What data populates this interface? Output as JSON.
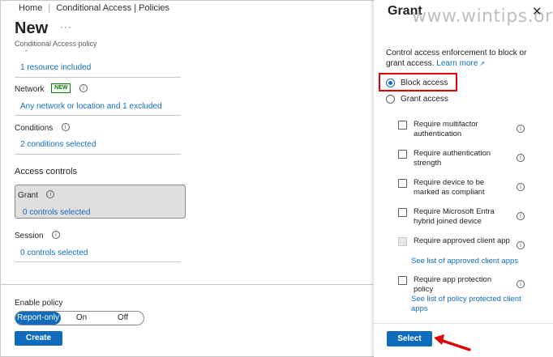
{
  "breadcrumb": {
    "home": "Home",
    "ca": "Conditional Access | Policies"
  },
  "page": {
    "title": "New",
    "more": "···",
    "subtitle": "Conditional Access policy",
    "dash": "-"
  },
  "resources": {
    "link": "1 resource included"
  },
  "network": {
    "label": "Network",
    "badge": "NEW",
    "link": "Any network or location and 1 excluded"
  },
  "conditions": {
    "label": "Conditions",
    "link": "2 conditions selected"
  },
  "access_controls": {
    "heading": "Access controls",
    "grant": {
      "label": "Grant",
      "link": "0 controls selected"
    },
    "session": {
      "label": "Session",
      "link": "0 controls selected"
    }
  },
  "enable_policy": {
    "label": "Enable policy",
    "options": [
      "Report-only",
      "On",
      "Off"
    ],
    "selected": "Report-only"
  },
  "create_label": "Create",
  "panel": {
    "title": "Grant",
    "watermark": "www.wintips.org",
    "description": "Control access enforcement to block or grant access.",
    "learn_more": "Learn more",
    "radios": [
      {
        "label": "Block access",
        "checked": true
      },
      {
        "label": "Grant access",
        "checked": false
      }
    ],
    "controls": [
      {
        "label": "Require multifactor authentication",
        "link": ""
      },
      {
        "label": "Require authentication strength",
        "link": ""
      },
      {
        "label": "Require device to be marked as compliant",
        "link": ""
      },
      {
        "label": "Require Microsoft Entra hybrid joined device",
        "link": ""
      },
      {
        "label": "Require approved client app",
        "link": "See list of approved client apps",
        "disabled": true
      },
      {
        "label": "Require app protection policy",
        "link": "See list of policy protected client apps"
      }
    ],
    "select_label": "Select"
  },
  "colors": {
    "accent": "#0f6cbd",
    "highlight": "#e00000",
    "new_badge": "#107c10"
  },
  "icons": {
    "info": "info-icon",
    "close": "close-icon",
    "external": "external-link-icon",
    "arrow": "red-arrow-icon"
  }
}
